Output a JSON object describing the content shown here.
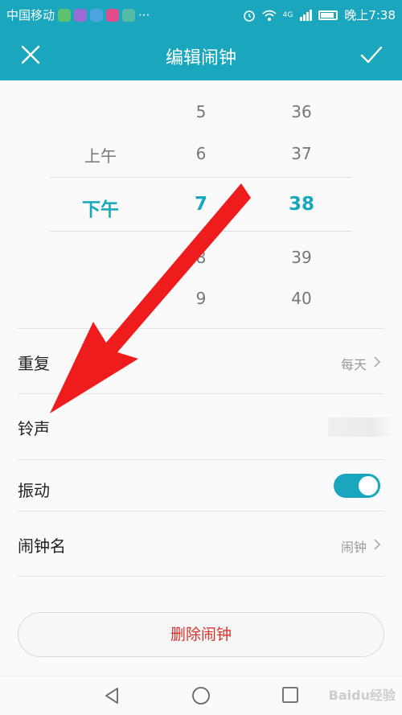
{
  "status_bar": {
    "carrier": "中国移动",
    "more": "···",
    "network": "4G",
    "time": "晚上7:38",
    "icons": [
      "alarm-icon",
      "wifi-icon",
      "signal-icon",
      "battery-icon"
    ]
  },
  "header": {
    "title": "编辑闹钟",
    "close_icon": "close-icon",
    "confirm_icon": "check-icon"
  },
  "picker": {
    "ampm": [
      "上午",
      "下午"
    ],
    "hours": [
      "5",
      "6",
      "7",
      "8",
      "9"
    ],
    "minutes": [
      "36",
      "37",
      "38",
      "39",
      "40"
    ],
    "selected": {
      "ampm": "下午",
      "hour": "7",
      "minute": "38"
    }
  },
  "settings": {
    "repeat": {
      "label": "重复",
      "value": "每天"
    },
    "ringtone": {
      "label": "铃声",
      "value": ""
    },
    "vibrate": {
      "label": "振动",
      "on": true
    },
    "alarm_name": {
      "label": "闹钟名",
      "value": "闹钟"
    }
  },
  "delete_label": "删除闹钟",
  "watermark": "Baidu经验",
  "colors": {
    "accent": "#1aa7bd",
    "delete": "#d9302c",
    "arrow": "#ee1c1c"
  }
}
